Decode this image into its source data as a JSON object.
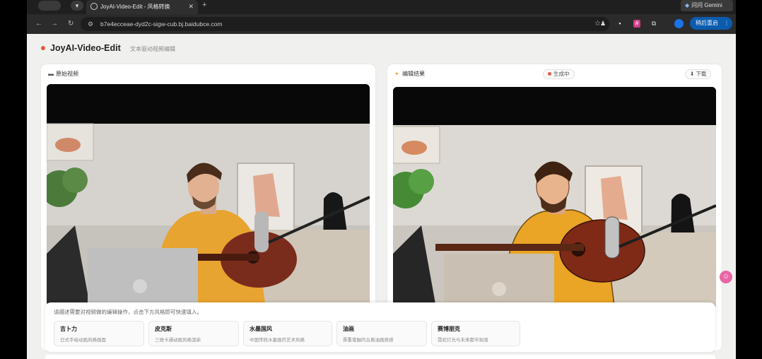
{
  "browser": {
    "tab_title": "JoyAI-Video-Edit - 风格转换",
    "tab_close": "✕",
    "new_tab": "+",
    "gemini_label": "问问 Gemini",
    "url": "b7e4ecceae-dyd2c-sigw-cub.bj.baidubce.com",
    "update_label": "稍后重启"
  },
  "app": {
    "title": "JoyAI-Video-Edit",
    "subtitle": "文本驱动视频编辑"
  },
  "source_panel": {
    "title": "原始视频"
  },
  "result_panel": {
    "title": "编辑结果",
    "status": "生成中",
    "download_label": "下载"
  },
  "prompt": {
    "hint": "请描述需要对视频做的编辑操作，点击下方风格即可快速填入。",
    "presets": [
      {
        "title": "吉卜力",
        "desc": "日式手绘动画风格画面"
      },
      {
        "title": "皮克斯",
        "desc": "三维卡通动画风格渲染"
      },
      {
        "title": "水墨国风",
        "desc": "中国传统水墨画的艺术风格"
      },
      {
        "title": "油画",
        "desc": "厚重笔触的古典油画质感"
      },
      {
        "title": "赛博朋克",
        "desc": "霓虹灯光与未来都市氛围"
      }
    ]
  },
  "icons": {
    "back": "back-arrow-icon",
    "forward": "forward-arrow-icon",
    "reload": "reload-icon",
    "bookmark": "star-icon"
  },
  "colors": {
    "accent": "#e5583a",
    "status_dot": "#e8574a",
    "update_button": "#0b5cad",
    "float_button": "#e766a6"
  }
}
